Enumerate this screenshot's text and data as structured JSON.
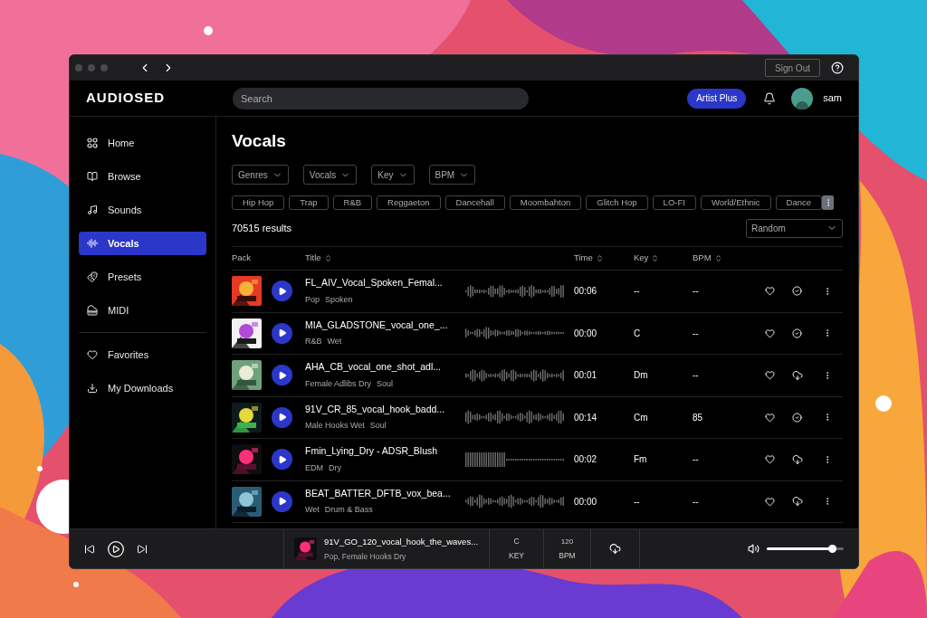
{
  "titlebar": {
    "sign_out": "Sign Out"
  },
  "header": {
    "logo": "AUDIOSED",
    "search": {
      "placeholder": "Search"
    },
    "plan_button": "Artist Plus",
    "user": "sam"
  },
  "sidebar": {
    "items": [
      {
        "label": "Home",
        "kind": "home",
        "selected": false
      },
      {
        "label": "Browse",
        "kind": "browse",
        "selected": false
      },
      {
        "label": "Sounds",
        "kind": "sounds",
        "selected": false
      },
      {
        "label": "Vocals",
        "kind": "vocals",
        "selected": true
      },
      {
        "label": "Presets",
        "kind": "presets",
        "selected": false
      },
      {
        "label": "MIDI",
        "kind": "midi",
        "selected": false
      }
    ],
    "secondary": [
      {
        "label": "Favorites",
        "kind": "favorites",
        "selected": false
      },
      {
        "label": "My Downloads",
        "kind": "downloads",
        "selected": false
      }
    ]
  },
  "page": {
    "title": "Vocals",
    "filters": [
      "Genres",
      "Vocals",
      "Key",
      "BPM"
    ],
    "chips": [
      "Hip Hop",
      "Trap",
      "R&B",
      "Reggaeton",
      "Dancehall",
      "Moombahton",
      "Glitch Hop",
      "LO-FI",
      "World/Ethnic",
      "Dance"
    ],
    "results": "70515 results",
    "sort": "Random"
  },
  "table": {
    "columns": [
      {
        "label": "Pack",
        "sortable": false
      },
      {
        "label": "Title",
        "sortable": true
      },
      {
        "label": "Time",
        "sortable": true
      },
      {
        "label": "Key",
        "sortable": true
      },
      {
        "label": "BPM",
        "sortable": true
      }
    ],
    "rows": [
      {
        "title": "FL_AIV_Vocal_Spoken_Femal...",
        "tags": [
          "Pop",
          "Spoken"
        ],
        "time": "00:06",
        "key": "--",
        "bpm": "--",
        "downloaded": true
      },
      {
        "title": "MIA_GLADSTONE_vocal_one_...",
        "tags": [
          "R&B",
          "Wet"
        ],
        "time": "00:00",
        "key": "C",
        "bpm": "--",
        "downloaded": true
      },
      {
        "title": "AHA_CB_vocal_one_shot_adl...",
        "tags": [
          "Female Adlibs Dry",
          "Soul"
        ],
        "time": "00:01",
        "key": "Dm",
        "bpm": "--",
        "downloaded": false
      },
      {
        "title": "91V_CR_85_vocal_hook_badd...",
        "tags": [
          "Male Hooks Wet",
          "Soul"
        ],
        "time": "00:14",
        "key": "Cm",
        "bpm": "85",
        "downloaded": true
      },
      {
        "title": "Fmin_Lying_Dry - ADSR_Blush",
        "tags": [
          "EDM",
          "Dry"
        ],
        "time": "00:02",
        "key": "Fm",
        "bpm": "--",
        "downloaded": false
      },
      {
        "title": "BEAT_BATTER_DFTB_vox_bea...",
        "tags": [
          "Wet",
          "Drum & Bass"
        ],
        "time": "00:00",
        "key": "--",
        "bpm": "--",
        "downloaded": false
      }
    ]
  },
  "player": {
    "title": "91V_GO_120_vocal_hook_the_waves...",
    "subtitle": "Pop, Female Hooks Dry",
    "key": "C",
    "key_label": "KEY",
    "bpm": "120",
    "bpm_label": "BPM",
    "volume": {
      "level": 0.85
    }
  }
}
